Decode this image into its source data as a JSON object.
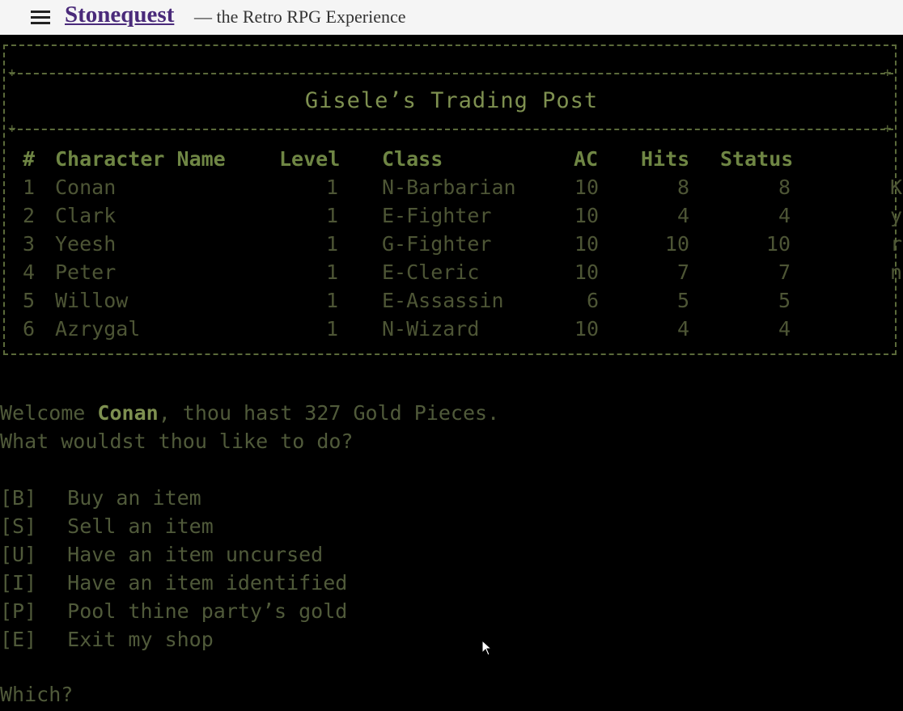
{
  "header": {
    "brand": "Stonequest",
    "tagline": "— the Retro RPG Experience",
    "menu_icon": "hamburger-menu-icon"
  },
  "shop": {
    "title": "Gisele’s Trading Post"
  },
  "party_table": {
    "headers": {
      "num": "#",
      "name": "Character Name",
      "level": "Level",
      "class": "Class",
      "ac": "AC",
      "hits": "Hits",
      "status": "Status"
    },
    "rows": [
      {
        "num": "1",
        "name": "Conan",
        "level": "1",
        "class": "N-Barbarian",
        "ac": "10",
        "hits": "8",
        "status": "8",
        "extra": "K"
      },
      {
        "num": "2",
        "name": "Clark",
        "level": "1",
        "class": "E-Fighter",
        "ac": "10",
        "hits": "4",
        "status": "4",
        "extra": "y"
      },
      {
        "num": "3",
        "name": "Yeesh",
        "level": "1",
        "class": "G-Fighter",
        "ac": "10",
        "hits": "10",
        "status": "10",
        "extra": "r"
      },
      {
        "num": "4",
        "name": "Peter",
        "level": "1",
        "class": "E-Cleric",
        "ac": "10",
        "hits": "7",
        "status": "7",
        "extra": "n"
      },
      {
        "num": "5",
        "name": "Willow",
        "level": "1",
        "class": "E-Assassin",
        "ac": "6",
        "hits": "5",
        "status": "5",
        "extra": ""
      },
      {
        "num": "6",
        "name": "Azrygal",
        "level": "1",
        "class": "N-Wizard",
        "ac": "10",
        "hits": "4",
        "status": "4",
        "extra": ""
      }
    ]
  },
  "messages": {
    "welcome_prefix": "Welcome ",
    "welcome_name": "Conan",
    "welcome_suffix": ", thou hast 327 Gold Pieces.",
    "question": "What wouldst thou like to do?",
    "prompt": "Which?"
  },
  "menu": [
    {
      "key": "[B]",
      "label": "Buy an item"
    },
    {
      "key": "[S]",
      "label": "Sell an item"
    },
    {
      "key": "[U]",
      "label": "Have an item uncursed"
    },
    {
      "key": "[I]",
      "label": "Have an item identified"
    },
    {
      "key": "[P]",
      "label": "Pool thine party’s gold"
    },
    {
      "key": "[E]",
      "label": "Exit my shop"
    }
  ],
  "colors": {
    "terminal_bg": "#000000",
    "terminal_text": "#505a3a",
    "terminal_highlight": "#7e9050",
    "brand": "#4a2a7a"
  }
}
